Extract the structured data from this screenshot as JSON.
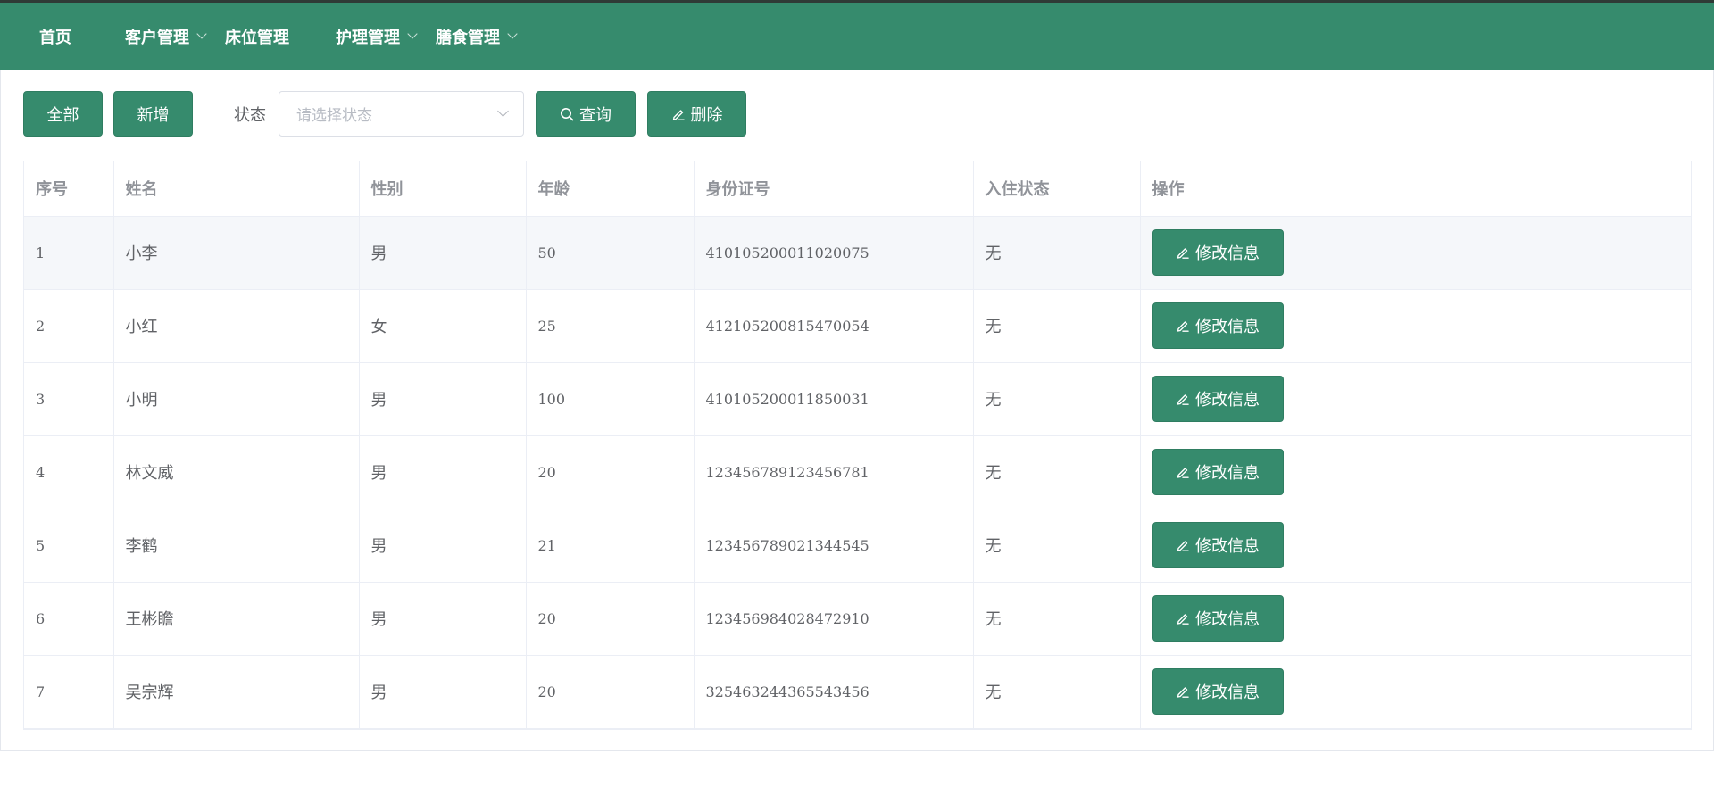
{
  "nav": {
    "items": [
      {
        "label": "首页",
        "has_dropdown": false
      },
      {
        "label": "客户管理",
        "has_dropdown": true
      },
      {
        "label": "床位管理",
        "has_dropdown": false
      },
      {
        "label": "护理管理",
        "has_dropdown": true
      },
      {
        "label": "膳食管理",
        "has_dropdown": true
      }
    ]
  },
  "toolbar": {
    "all_label": "全部",
    "add_label": "新增",
    "status_label": "状态",
    "status_placeholder": "请选择状态",
    "search_label": "查询",
    "delete_label": "删除"
  },
  "table": {
    "columns": [
      "序号",
      "姓名",
      "性别",
      "年龄",
      "身份证号",
      "入住状态",
      "操作"
    ],
    "edit_label": "修改信息",
    "rows": [
      {
        "no": "1",
        "name": "小李",
        "gender": "男",
        "age": "50",
        "id_card": "410105200011020075",
        "status": "无"
      },
      {
        "no": "2",
        "name": "小红",
        "gender": "女",
        "age": "25",
        "id_card": "412105200815470054",
        "status": "无"
      },
      {
        "no": "3",
        "name": "小明",
        "gender": "男",
        "age": "100",
        "id_card": "410105200011850031",
        "status": "无"
      },
      {
        "no": "4",
        "name": "林文威",
        "gender": "男",
        "age": "20",
        "id_card": "123456789123456781",
        "status": "无"
      },
      {
        "no": "5",
        "name": "李鹤",
        "gender": "男",
        "age": "21",
        "id_card": "123456789021344545",
        "status": "无"
      },
      {
        "no": "6",
        "name": "王彬瞻",
        "gender": "男",
        "age": "20",
        "id_card": "123456984028472910",
        "status": "无"
      },
      {
        "no": "7",
        "name": "吴宗辉",
        "gender": "男",
        "age": "20",
        "id_card": "325463244365543456",
        "status": "无"
      }
    ]
  },
  "colors": {
    "primary": "#368b6d",
    "header_row_bg": "#f5f7fa",
    "border": "#ebeef5"
  },
  "icons": {
    "search": "search-icon",
    "edit": "pencil-icon",
    "dropdown": "chevron-down-icon"
  }
}
